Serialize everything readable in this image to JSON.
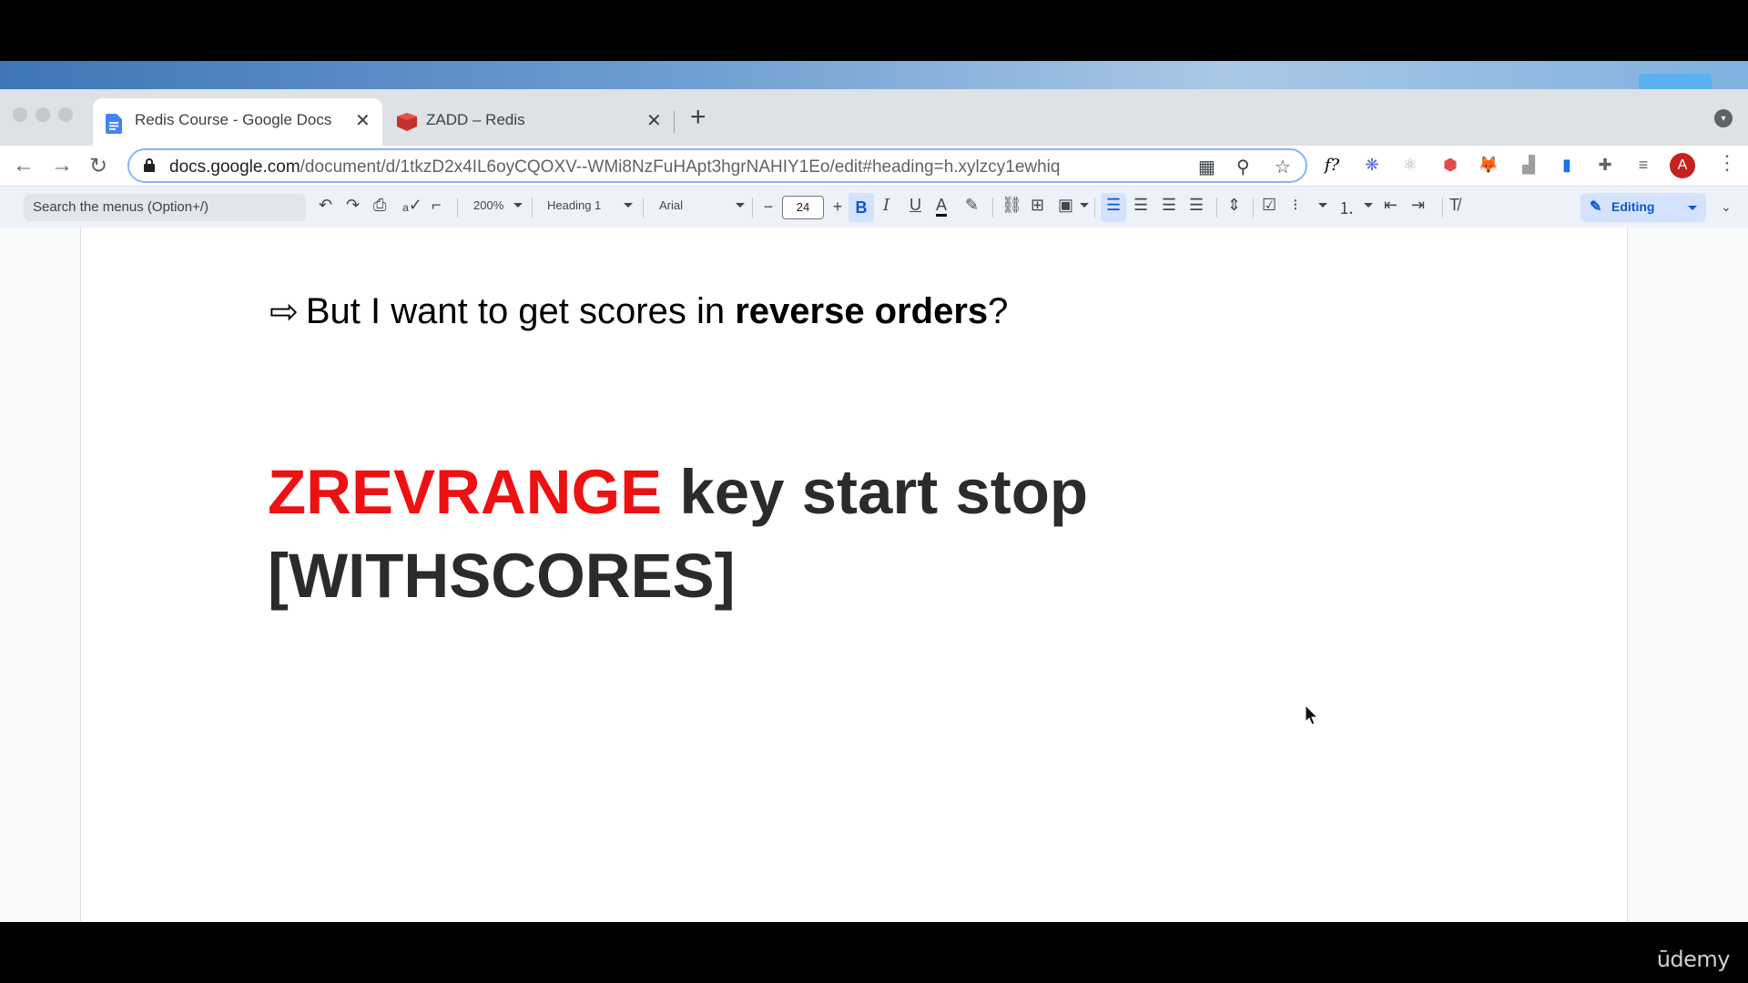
{
  "tabs": [
    {
      "title": "Redis Course - Google Docs",
      "icon": "google-docs-icon",
      "active": true
    },
    {
      "title": "ZADD – Redis",
      "icon": "redis-icon",
      "active": false
    }
  ],
  "address_bar": {
    "url_host": "docs.google.com",
    "url_path": "/document/d/1tkzD2x4IL6oyCQOXV--WMi8NzFuHApt3hgrNAHIY1Eo/edit#heading=h.xylzcy1ewhiq"
  },
  "profile": {
    "initial": "A"
  },
  "docs_toolbar": {
    "menu_search_placeholder": "Search the menus (Option+/)",
    "zoom": "200%",
    "style": "Heading 1",
    "font": "Arial",
    "font_size": "24",
    "mode": "Editing"
  },
  "document": {
    "line1_prefix": "But I want to get scores in ",
    "line1_bold": "reverse orders",
    "line1_suffix": "?",
    "command_keyword": "ZREVRANGE",
    "command_args": " key start stop",
    "command_option": "[WITHSCORES]"
  },
  "watermark": "ūdemy",
  "colors": {
    "command_keyword": "#ee1111",
    "command_text": "#2b2b2b",
    "tab_strip": "#dee1e6",
    "docs_toolbar": "#edf2fa",
    "accent": "#0b57d0"
  }
}
